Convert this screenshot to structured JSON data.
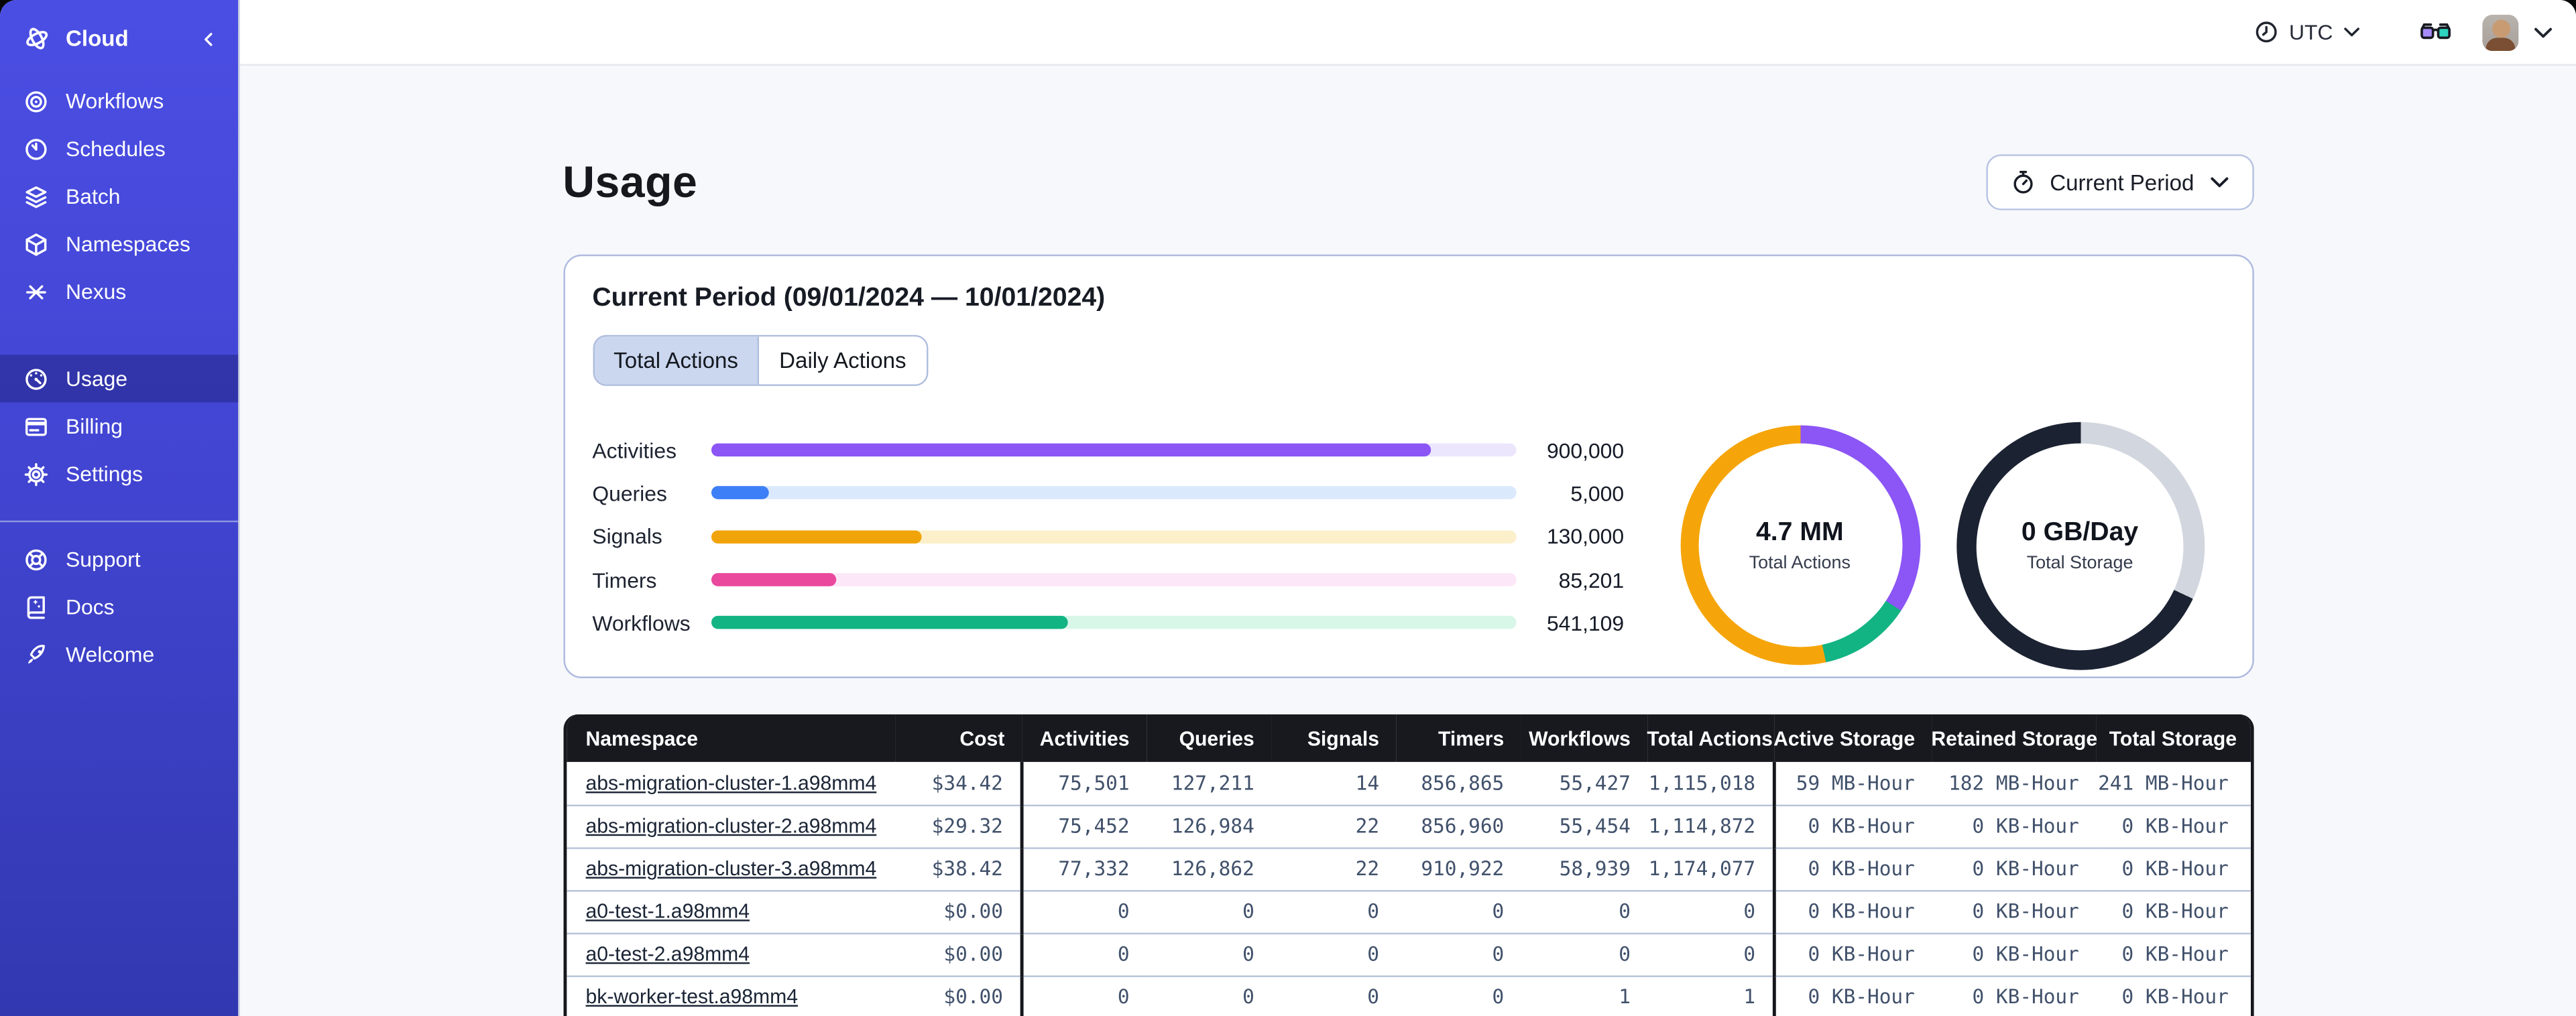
{
  "sidebar": {
    "header": {
      "label": "Cloud"
    },
    "main": [
      {
        "label": "Workflows"
      },
      {
        "label": "Schedules"
      },
      {
        "label": "Batch"
      },
      {
        "label": "Namespaces"
      },
      {
        "label": "Nexus"
      }
    ],
    "account": [
      {
        "label": "Usage",
        "active": true
      },
      {
        "label": "Billing",
        "active": false
      },
      {
        "label": "Settings",
        "active": false
      }
    ],
    "footer": [
      {
        "label": "Support"
      },
      {
        "label": "Docs"
      },
      {
        "label": "Welcome"
      }
    ]
  },
  "topbar": {
    "timezone": "UTC"
  },
  "main": {
    "title": "Usage",
    "period_button_label": "Current Period",
    "card": {
      "title": "Current Period (09/01/2024 — 10/01/2024)",
      "tabs": [
        {
          "label": "Total Actions",
          "selected": true
        },
        {
          "label": "Daily Actions",
          "selected": false
        }
      ]
    }
  },
  "chart_data": [
    {
      "type": "bar",
      "title": "Current period totals by action type",
      "categories": [
        "Activities",
        "Queries",
        "Signals",
        "Timers",
        "Workflows"
      ],
      "values": [
        900000,
        5000,
        130000,
        85201,
        541109
      ],
      "value_labels": [
        "900,000",
        "5,000",
        "130,000",
        "85,201",
        "541,109"
      ],
      "fill_pct": [
        89.5,
        7.2,
        26.2,
        15.6,
        44.3
      ],
      "colors": [
        "#8C55F6",
        "#3D7FF7",
        "#F1A40A",
        "#E9489D",
        "#12B483"
      ],
      "track_colors": [
        "#ECE6FD",
        "#DBE9FD",
        "#FCF0CB",
        "#FCE7F8",
        "#D9F7E9"
      ],
      "xlabel": "",
      "ylabel": "",
      "legend": "none",
      "grid": false
    },
    {
      "type": "pie",
      "label": "4.7 MM",
      "sublabel": "Total Actions",
      "segments": [
        {
          "name": "activities",
          "color": "#8C55F6",
          "pct": 34.2
        },
        {
          "name": "workflows",
          "color": "#12B483",
          "pct": 12.4
        },
        {
          "name": "signals",
          "color": "#F5A50A",
          "pct": 53.4
        }
      ]
    },
    {
      "type": "pie",
      "label": "0 GB/Day",
      "sublabel": "Total Storage",
      "segments": [
        {
          "name": "remaining",
          "color": "#D2D6DE",
          "pct": 32
        },
        {
          "name": "used",
          "color": "#1B2232",
          "pct": 68
        }
      ]
    }
  ],
  "table": {
    "columns": [
      "Namespace",
      "Cost",
      "Activities",
      "Queries",
      "Signals",
      "Timers",
      "Workflows",
      "Total Actions",
      "Active Storage",
      "Retained Storage",
      "Total Storage"
    ],
    "rows": [
      {
        "cells": [
          "abs-migration-cluster-1.a98mm4",
          "$34.42",
          "75,501",
          "127,211",
          "14",
          "856,865",
          "55,427",
          "1,115,018",
          "59 MB-Hour",
          "182 MB-Hour",
          "241 MB-Hour"
        ]
      },
      {
        "cells": [
          "abs-migration-cluster-2.a98mm4",
          "$29.32",
          "75,452",
          "126,984",
          "22",
          "856,960",
          "55,454",
          "1,114,872",
          "0 KB-Hour",
          "0 KB-Hour",
          "0 KB-Hour"
        ]
      },
      {
        "cells": [
          "abs-migration-cluster-3.a98mm4",
          "$38.42",
          "77,332",
          "126,862",
          "22",
          "910,922",
          "58,939",
          "1,174,077",
          "0 KB-Hour",
          "0 KB-Hour",
          "0 KB-Hour"
        ]
      },
      {
        "cells": [
          "a0-test-1.a98mm4",
          "$0.00",
          "0",
          "0",
          "0",
          "0",
          "0",
          "0",
          "0 KB-Hour",
          "0 KB-Hour",
          "0 KB-Hour"
        ]
      },
      {
        "cells": [
          "a0-test-2.a98mm4",
          "$0.00",
          "0",
          "0",
          "0",
          "0",
          "0",
          "0",
          "0 KB-Hour",
          "0 KB-Hour",
          "0 KB-Hour"
        ]
      },
      {
        "cells": [
          "bk-worker-test.a98mm4",
          "$0.00",
          "0",
          "0",
          "0",
          "0",
          "1",
          "1",
          "0 KB-Hour",
          "0 KB-Hour",
          "0 KB-Hour"
        ]
      }
    ]
  }
}
